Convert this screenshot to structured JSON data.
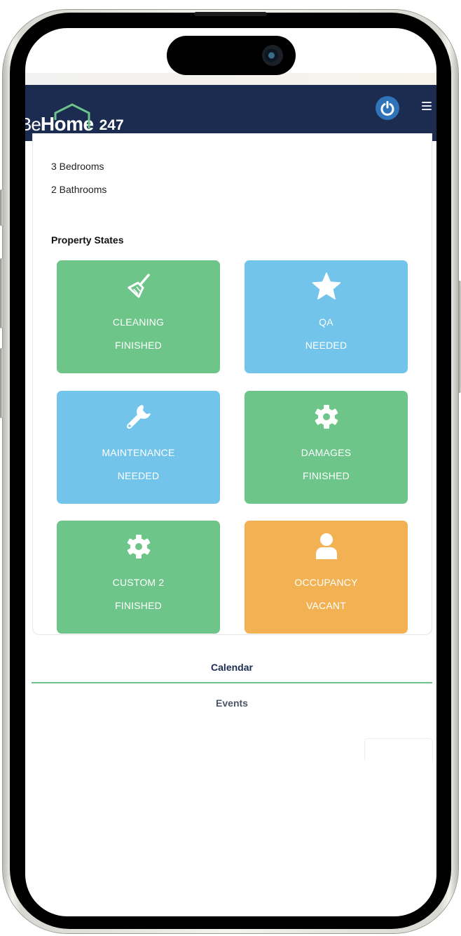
{
  "header": {
    "logo": {
      "be": "Be",
      "home": "Home",
      "suffix": "247"
    },
    "power_icon": "power-icon",
    "menu_icon": "hamburger-menu-icon"
  },
  "property": {
    "bedrooms": "3 Bedrooms",
    "bathrooms": "2 Bathrooms",
    "section_title": "Property States"
  },
  "states": [
    {
      "name": "CLEANING",
      "status": "FINISHED",
      "icon": "broom-icon",
      "color": "#6dc58a"
    },
    {
      "name": "QA",
      "status": "NEEDED",
      "icon": "star-icon",
      "color": "#72c4ea"
    },
    {
      "name": "MAINTENANCE",
      "status": "NEEDED",
      "icon": "wrench-icon",
      "color": "#72c4ea"
    },
    {
      "name": "DAMAGES",
      "status": "FINISHED",
      "icon": "gear-icon",
      "color": "#6dc58a"
    },
    {
      "name": "CUSTOM 2",
      "status": "FINISHED",
      "icon": "gear-icon",
      "color": "#6dc58a"
    },
    {
      "name": "OCCUPANCY",
      "status": "VACANT",
      "icon": "user-icon",
      "color": "#f2b254"
    }
  ],
  "tabs": [
    {
      "label": "Calendar",
      "active": true
    },
    {
      "label": "Events",
      "active": false
    }
  ],
  "colors": {
    "header_bg": "#1c2b50",
    "accent_green": "#6cc48a",
    "power_blue": "#2f74b8"
  }
}
